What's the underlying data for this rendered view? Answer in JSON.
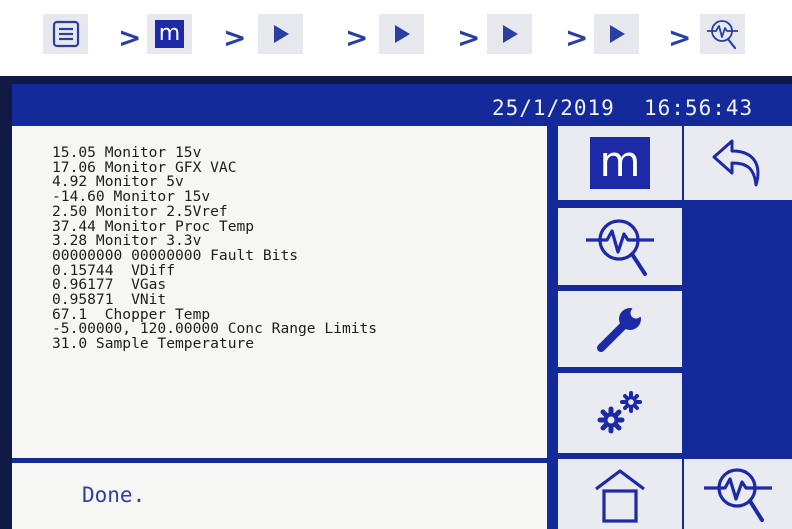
{
  "breadcrumb": {
    "m_label": "m",
    "separator": ">"
  },
  "header": {
    "date": "25/1/2019",
    "time": "16:56:43"
  },
  "readings": [
    "15.05 Monitor 15v",
    "17.06 Monitor GFX VAC",
    "4.92 Monitor 5v",
    "-14.60 Monitor 15v",
    "2.50 Monitor 2.5Vref",
    "37.44 Monitor Proc Temp",
    "3.28 Monitor 3.3v",
    "00000000 00000000 Fault Bits",
    "0.15744  VDiff",
    "0.96177  VGas",
    "0.95871  VNit",
    "67.1  Chopper Temp",
    "-5.00000, 120.00000 Conc Range Limits",
    "31.0 Sample Temperature"
  ],
  "status": {
    "text": "Done."
  },
  "nav": {
    "menu_label": "m"
  },
  "colors": {
    "screen_blue": "#142a9b",
    "accent_blue": "#1c2aa8",
    "button_bg": "#eaeaf1",
    "panel_bg": "#f6f6f4"
  },
  "icons": {
    "breadcrumb": [
      "document-list-icon",
      "m-icon",
      "play-icon",
      "play-icon",
      "play-icon",
      "play-icon",
      "diagnostics-magnifier-icon"
    ],
    "sidebar": [
      "m-icon",
      "diagnostics-magnifier-icon",
      "wrench-icon",
      "gears-icon",
      "home-icon",
      "back-arrow-icon",
      "diagnostics-magnifier-icon"
    ]
  }
}
